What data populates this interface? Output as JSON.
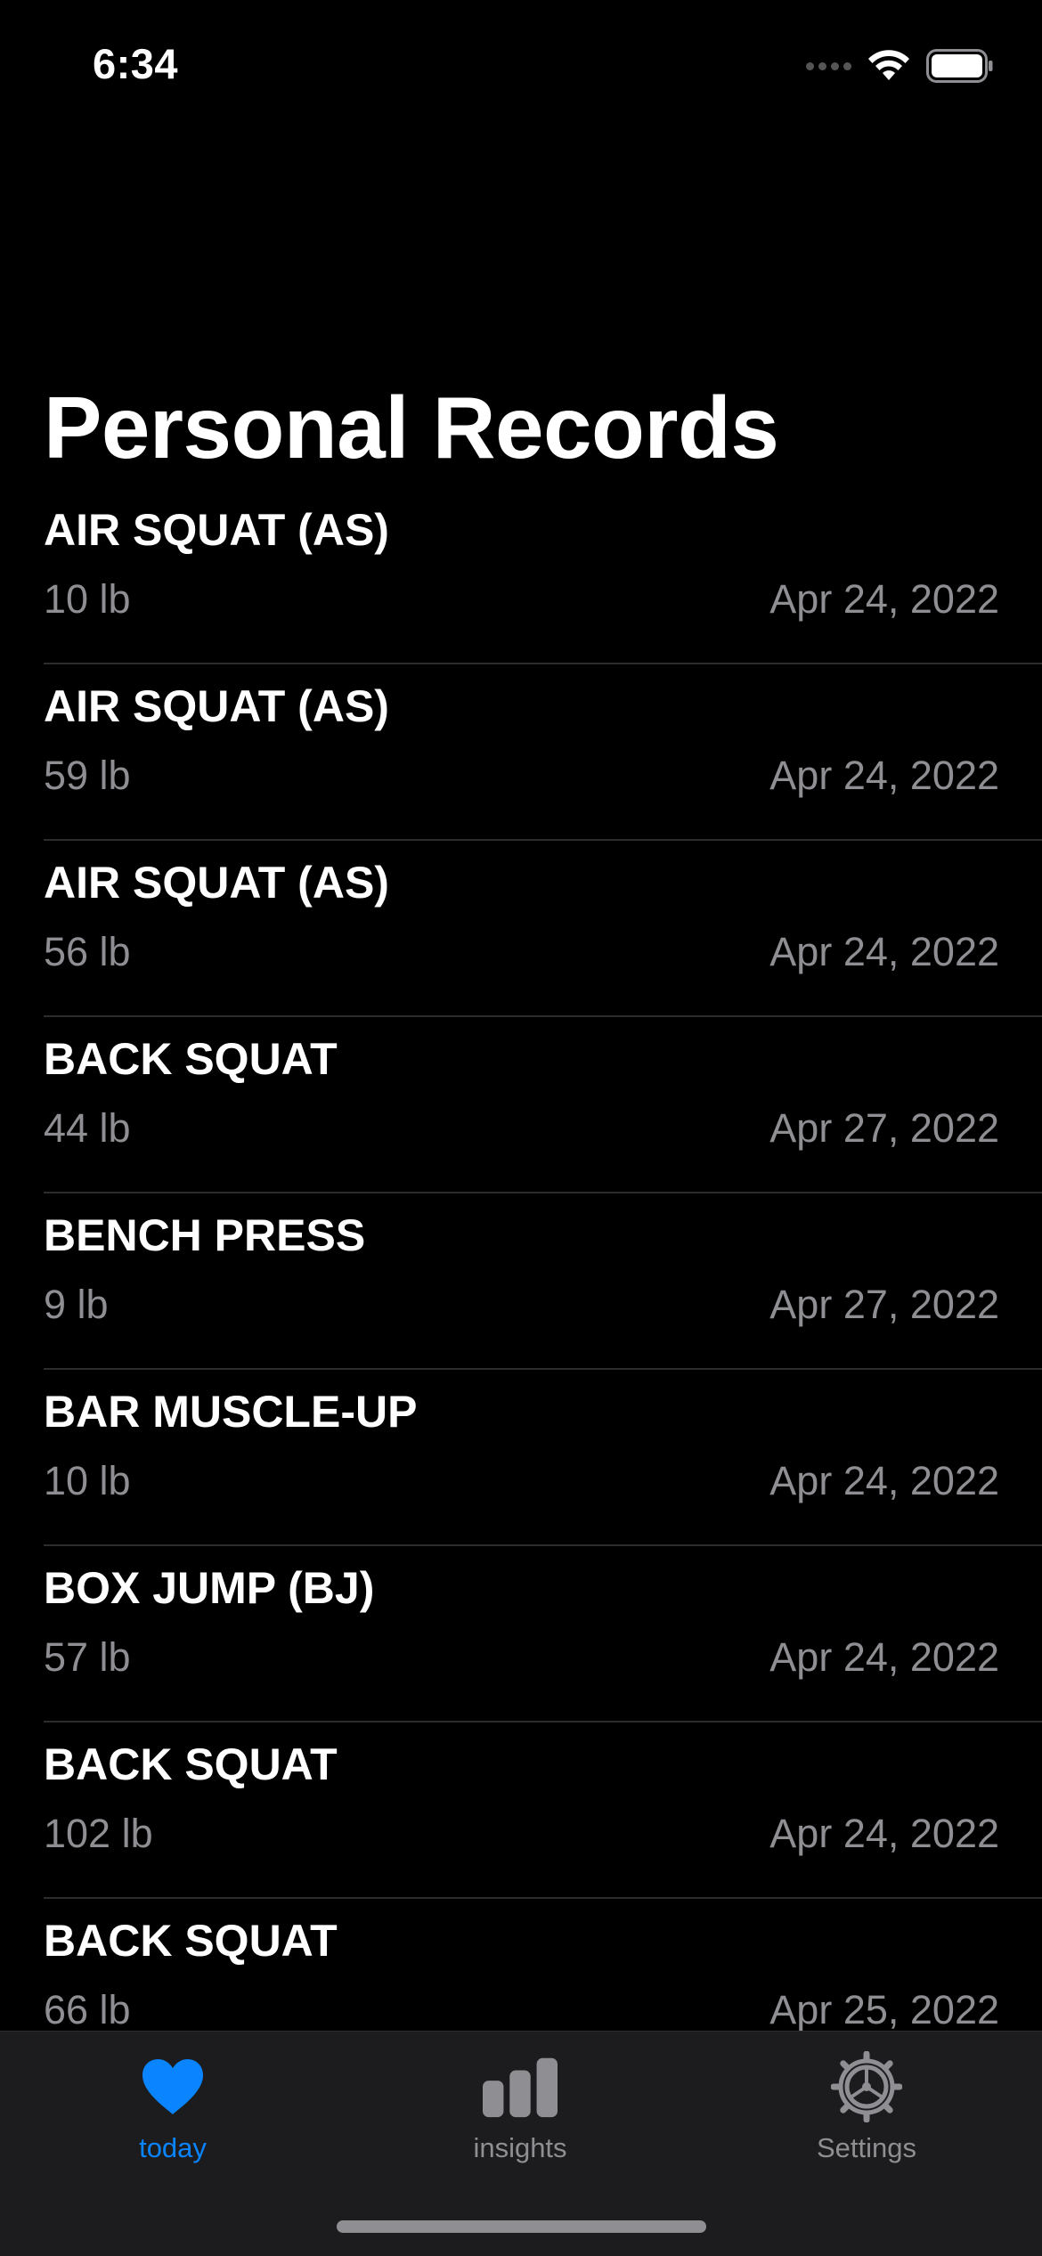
{
  "status_bar": {
    "time": "6:34"
  },
  "page": {
    "title": "Personal Records"
  },
  "records": [
    {
      "name": "AIR SQUAT (AS)",
      "weight": "10 lb",
      "date": "Apr 24, 2022"
    },
    {
      "name": "AIR SQUAT (AS)",
      "weight": "59 lb",
      "date": "Apr 24, 2022"
    },
    {
      "name": "AIR SQUAT (AS)",
      "weight": "56 lb",
      "date": "Apr 24, 2022"
    },
    {
      "name": "BACK SQUAT",
      "weight": "44 lb",
      "date": "Apr 27, 2022"
    },
    {
      "name": "BENCH PRESS",
      "weight": "9 lb",
      "date": "Apr 27, 2022"
    },
    {
      "name": "BAR MUSCLE-UP",
      "weight": "10 lb",
      "date": "Apr 24, 2022"
    },
    {
      "name": "BOX JUMP (BJ)",
      "weight": "57 lb",
      "date": "Apr 24, 2022"
    },
    {
      "name": "BACK SQUAT",
      "weight": "102 lb",
      "date": "Apr 24, 2022"
    },
    {
      "name": "BACK SQUAT",
      "weight": "66 lb",
      "date": "Apr 25, 2022"
    }
  ],
  "tab_bar": {
    "tabs": [
      {
        "label": "today",
        "icon": "heart-icon",
        "active": true
      },
      {
        "label": "insights",
        "icon": "bar-chart-icon",
        "active": false
      },
      {
        "label": "Settings",
        "icon": "gear-icon",
        "active": false
      }
    ]
  },
  "colors": {
    "background": "#000000",
    "accent": "#0a84ff",
    "secondary_text": "#8e8e93",
    "tab_bar_background": "#1c1c1e"
  }
}
